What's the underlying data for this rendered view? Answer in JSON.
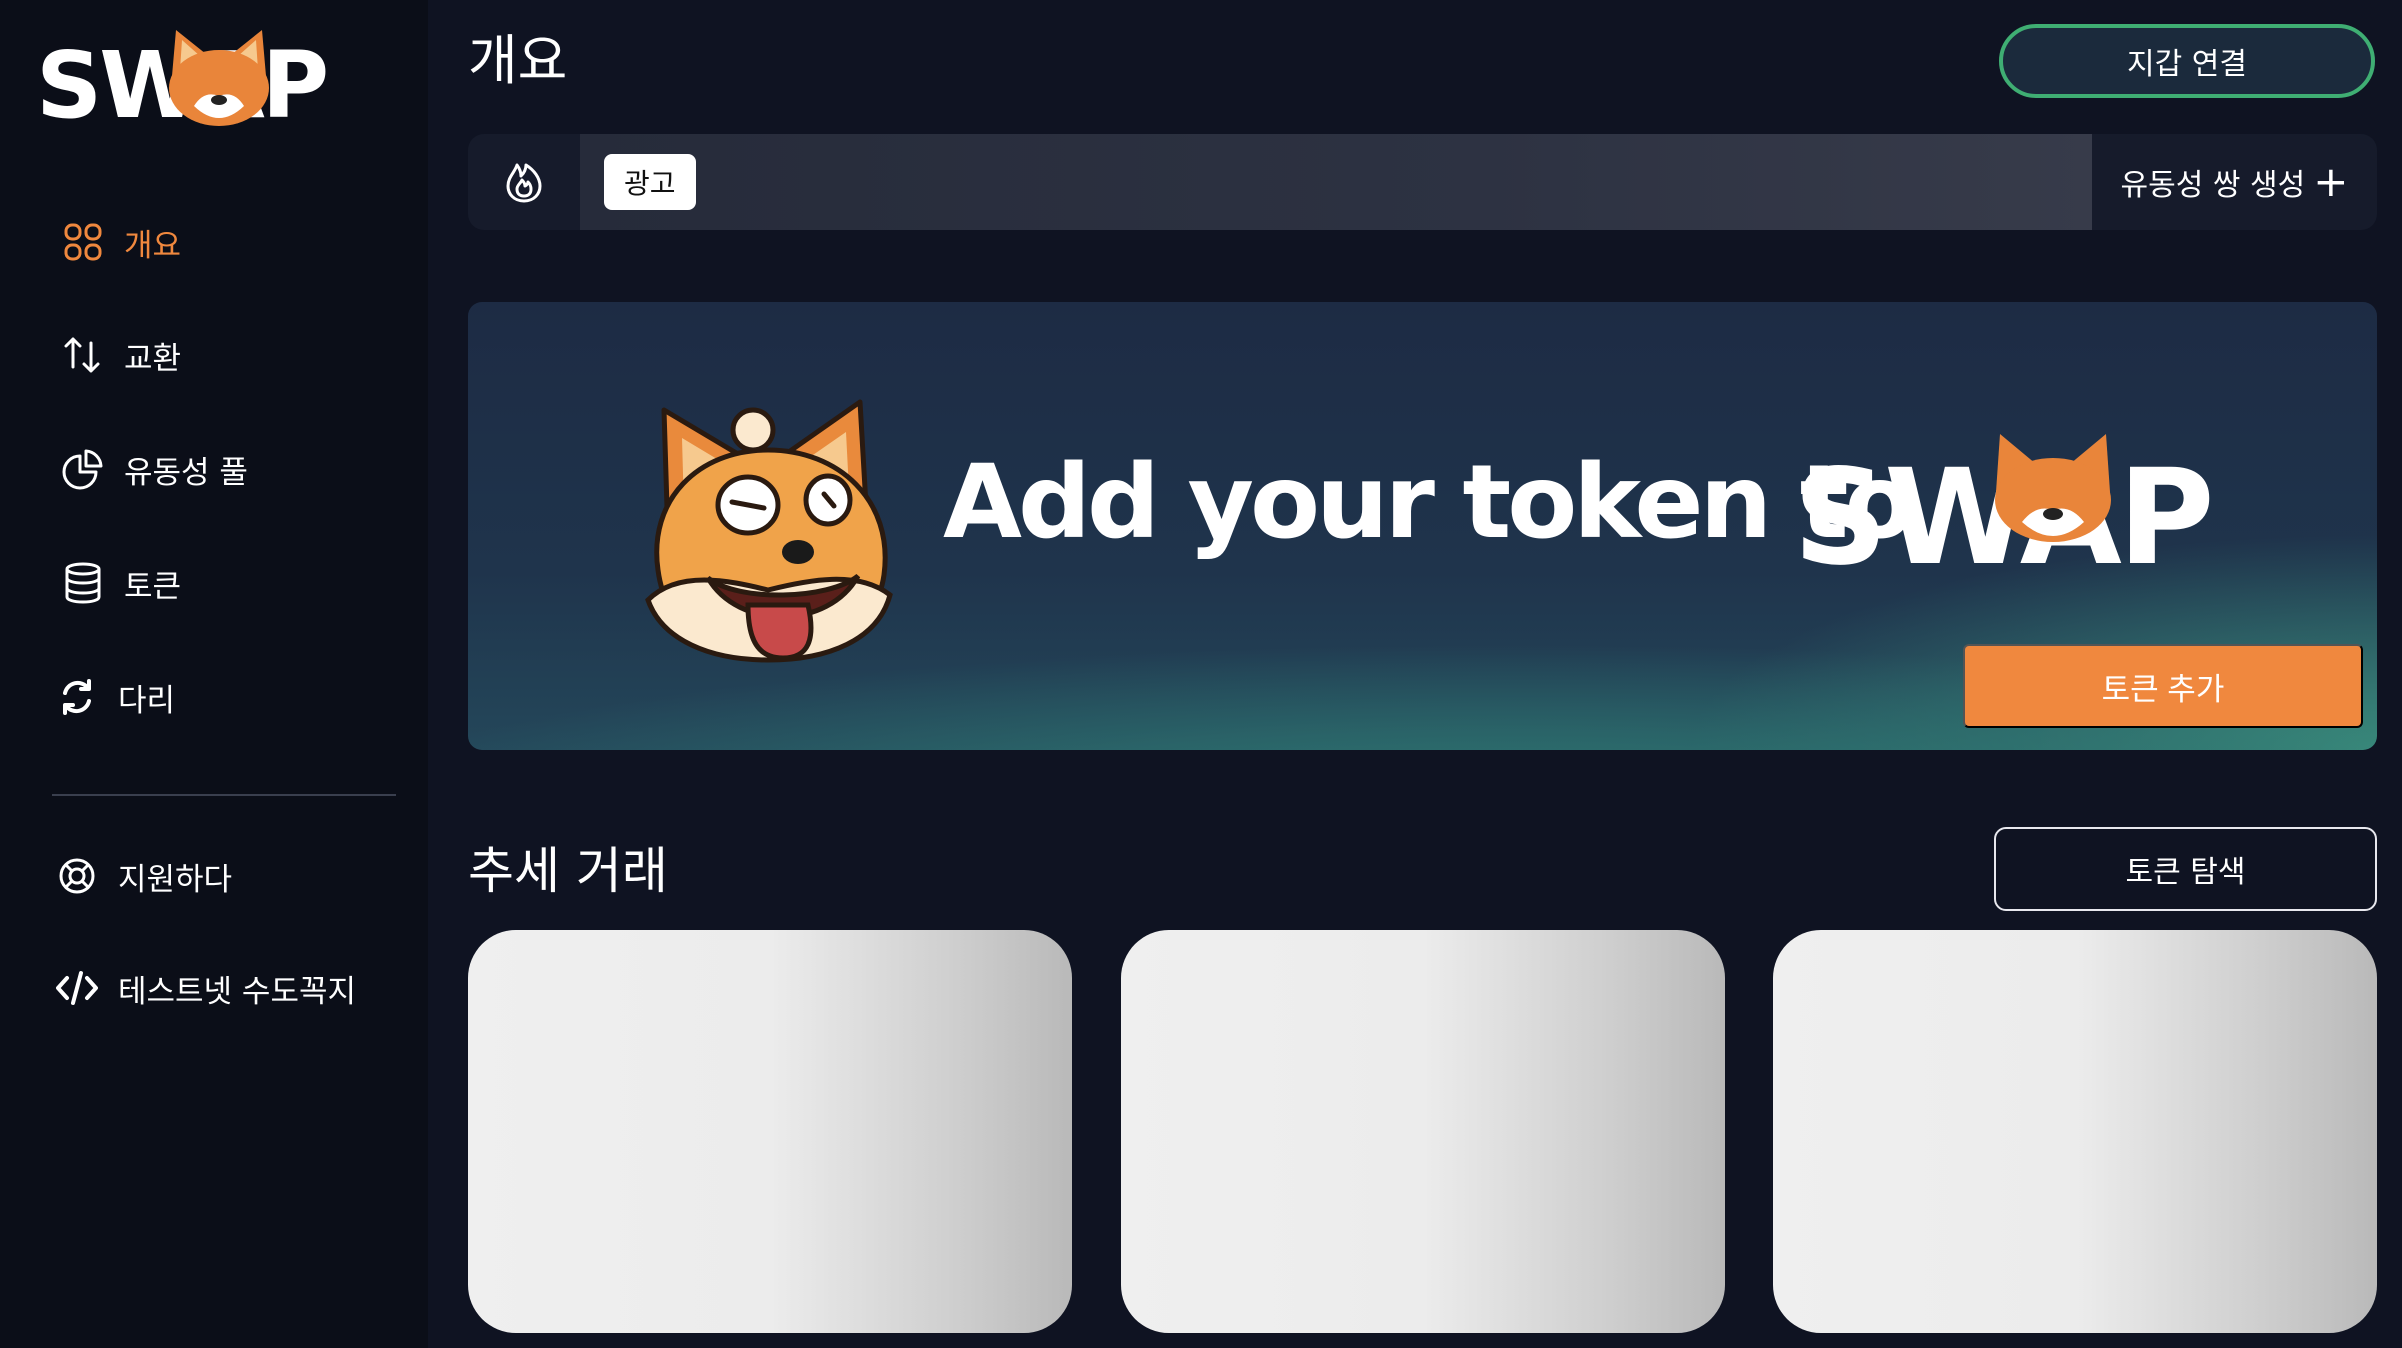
{
  "logo": {
    "text": "SWAP"
  },
  "sidebar": {
    "items": [
      {
        "label": "개요",
        "icon": "grid-icon",
        "active": true
      },
      {
        "label": "교환",
        "icon": "swap-arrows-icon",
        "active": false
      },
      {
        "label": "유동성 풀",
        "icon": "pie-chart-icon",
        "active": false
      },
      {
        "label": "토큰",
        "icon": "database-icon",
        "active": false
      },
      {
        "label": "다리",
        "icon": "refresh-icon",
        "active": false
      }
    ],
    "secondary": [
      {
        "label": "지원하다",
        "icon": "lifebuoy-icon"
      },
      {
        "label": "테스트넷 수도꼭지",
        "icon": "code-icon"
      }
    ]
  },
  "header": {
    "title": "개요",
    "connect_wallet": "지갑 연결"
  },
  "ad_bar": {
    "icon": "flame-icon",
    "badge": "광고",
    "create_pair": "유동성 쌍 생성",
    "create_pair_plus": "+"
  },
  "banner": {
    "text": "Add your token to",
    "brand": "SWAP",
    "button": "토큰 추가"
  },
  "trending": {
    "title": "추세 거래",
    "explore_button": "토큰 탐색",
    "cards": [
      {},
      {},
      {}
    ]
  },
  "colors": {
    "background": "#0f1322",
    "sidebar": "#0b0e18",
    "accent_orange": "#f0883e",
    "accent_green": "#3fae73"
  }
}
